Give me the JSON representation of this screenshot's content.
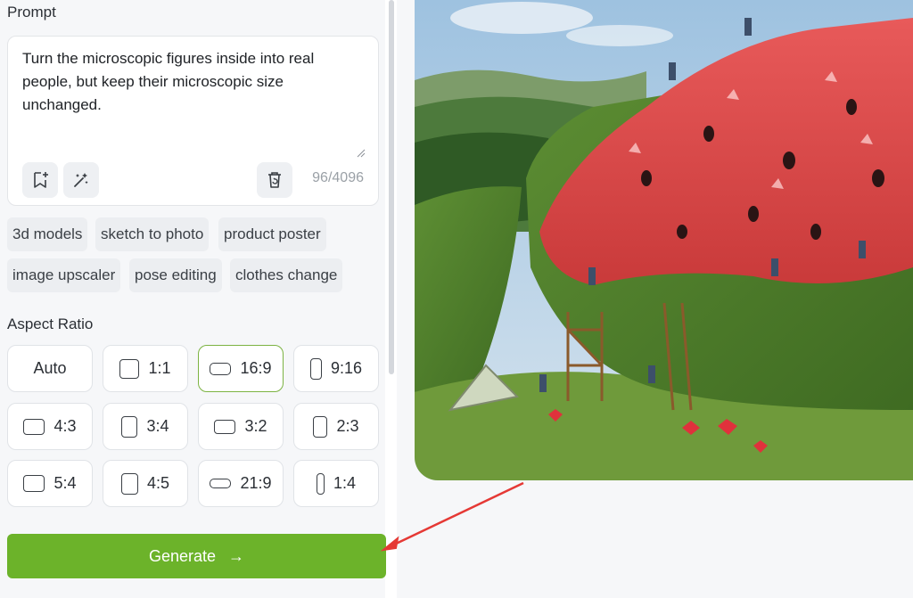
{
  "prompt": {
    "label": "Prompt",
    "text": "Turn the microscopic figures inside into real people, but keep their microscopic size unchanged.",
    "char_count": "96/4096"
  },
  "icons": {
    "bookmark": "bookmark-add-icon",
    "magic": "magic-wand-icon",
    "clear": "trash-restore-icon",
    "arrow": "arrow-right-icon"
  },
  "tags": [
    "3d models",
    "sketch to photo",
    "product poster",
    "image upscaler",
    "pose editing",
    "clothes change"
  ],
  "aspect_ratio": {
    "label": "Aspect Ratio",
    "options": [
      "Auto",
      "1:1",
      "16:9",
      "9:16",
      "4:3",
      "3:4",
      "3:2",
      "2:3",
      "5:4",
      "4:5",
      "21:9",
      "1:4"
    ],
    "selected": "16:9"
  },
  "generate": {
    "label": "Generate",
    "arrow": "→"
  },
  "colors": {
    "accent": "#6cb32a",
    "selected_border": "#7cb342",
    "annotation_arrow": "#e53935"
  },
  "preview": {
    "description_icon": "generated-image"
  }
}
